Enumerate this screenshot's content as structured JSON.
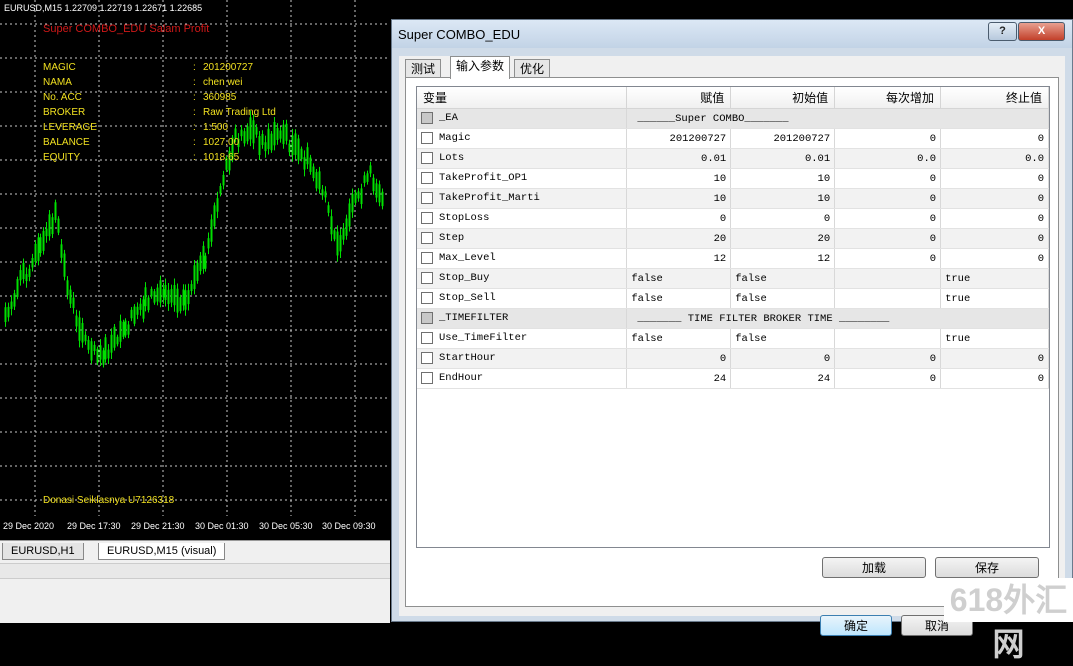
{
  "chart": {
    "header": "EURUSD,M15  1.22709 1.22719 1.22671 1.22685",
    "ea_title": "Super COMBO_EDU Salam Profit",
    "info": [
      {
        "label": "MAGIC",
        "sep": ":",
        "value": "201200727"
      },
      {
        "label": "NAMA",
        "sep": ":",
        "value": "chen wei"
      },
      {
        "label": "No. ACC",
        "sep": ":",
        "value": "360985"
      },
      {
        "label": "BROKER",
        "sep": ":",
        "value": "Raw Trading Ltd"
      },
      {
        "label": "LEVERAGE",
        "sep": ":",
        "value": "1:500"
      },
      {
        "label": "BALANCE",
        "sep": ":",
        "value": "1027.00"
      },
      {
        "label": "EQUITY",
        "sep": ":",
        "value": "1018.65"
      }
    ],
    "donation": "Donasi Seiklasnya U7126318",
    "time_labels": [
      "29 Dec 2020",
      "29 Dec 17:30",
      "29 Dec 21:30",
      "30 Dec 01:30",
      "30 Dec 05:30",
      "30 Dec 09:30"
    ],
    "tabs": [
      "EURUSD,H1",
      "EURUSD,M15 (visual)"
    ],
    "candle_color": "#00e000",
    "grid_color": "#c8c8c8"
  },
  "dialog": {
    "title": "Super COMBO_EDU",
    "help_label": "?",
    "close_label": "X",
    "tabs": [
      "测试",
      "输入参数",
      "优化"
    ],
    "active_tab": "输入参数",
    "columns": [
      "变量",
      "赋值",
      "初始值",
      "每次增加",
      "终止值"
    ],
    "rows": [
      {
        "name": "_EA",
        "group": true,
        "text": "______Super COMBO_______"
      },
      {
        "name": "Magic",
        "value": "201200727",
        "start": "201200727",
        "step": "0",
        "stop": "0"
      },
      {
        "name": "Lots",
        "value": "0.01",
        "start": "0.01",
        "step": "0.0",
        "stop": "0.0"
      },
      {
        "name": "TakeProfit_OP1",
        "value": "10",
        "start": "10",
        "step": "0",
        "stop": "0"
      },
      {
        "name": "TakeProfit_Marti",
        "value": "10",
        "start": "10",
        "step": "0",
        "stop": "0"
      },
      {
        "name": "StopLoss",
        "value": "0",
        "start": "0",
        "step": "0",
        "stop": "0"
      },
      {
        "name": "Step",
        "value": "20",
        "start": "20",
        "step": "0",
        "stop": "0"
      },
      {
        "name": "Max_Level",
        "value": "12",
        "start": "12",
        "step": "0",
        "stop": "0"
      },
      {
        "name": "Stop_Buy",
        "bool": true,
        "value": "false",
        "start": "false",
        "step": "",
        "stop": "true"
      },
      {
        "name": "Stop_Sell",
        "bool": true,
        "value": "false",
        "start": "false",
        "step": "",
        "stop": "true"
      },
      {
        "name": "_TIMEFILTER",
        "group": true,
        "text": "_______ TIME FILTER BROKER TIME ________"
      },
      {
        "name": "Use_TimeFilter",
        "bool": true,
        "value": "false",
        "start": "false",
        "step": "",
        "stop": "true"
      },
      {
        "name": "StartHour",
        "value": "0",
        "start": "0",
        "step": "0",
        "stop": "0"
      },
      {
        "name": "EndHour",
        "value": "24",
        "start": "24",
        "step": "0",
        "stop": "0"
      }
    ],
    "buttons": {
      "load": "加载",
      "save": "保存",
      "ok": "确定",
      "cancel": "取消"
    }
  },
  "watermark": "618外汇网"
}
